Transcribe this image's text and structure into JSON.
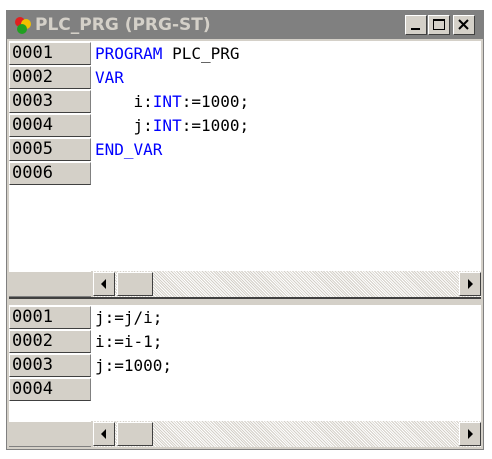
{
  "window": {
    "title": "PLC_PRG (PRG-ST)",
    "icon": "pou-program-icon",
    "buttons": [
      "minimize",
      "maximize",
      "close"
    ]
  },
  "declaration_pane": {
    "lines": [
      {
        "num": "0001",
        "parts": [
          {
            "t": "PROGRAM",
            "kw": true
          },
          {
            "t": " PLC_PRG",
            "kw": false
          }
        ]
      },
      {
        "num": "0002",
        "parts": [
          {
            "t": "VAR",
            "kw": true
          }
        ]
      },
      {
        "num": "0003",
        "parts": [
          {
            "t": "    i:",
            "kw": false
          },
          {
            "t": "INT",
            "kw": true
          },
          {
            "t": ":=1000;",
            "kw": false
          }
        ]
      },
      {
        "num": "0004",
        "parts": [
          {
            "t": "    j:",
            "kw": false
          },
          {
            "t": "INT",
            "kw": true
          },
          {
            "t": ":=1000;",
            "kw": false
          }
        ]
      },
      {
        "num": "0005",
        "parts": [
          {
            "t": "END_VAR",
            "kw": true
          }
        ]
      },
      {
        "num": "0006",
        "parts": []
      }
    ]
  },
  "body_pane": {
    "lines": [
      {
        "num": "0001",
        "parts": [
          {
            "t": "j:=j/i;",
            "kw": false
          }
        ]
      },
      {
        "num": "0002",
        "parts": [
          {
            "t": "i:=i-1;",
            "kw": false
          }
        ]
      },
      {
        "num": "0003",
        "parts": [
          {
            "t": "j:=1000;",
            "kw": false
          }
        ]
      },
      {
        "num": "0004",
        "parts": []
      }
    ]
  },
  "colors": {
    "keyword": "#0000ff",
    "text": "#000000",
    "titlebar_inactive": "#808080"
  }
}
